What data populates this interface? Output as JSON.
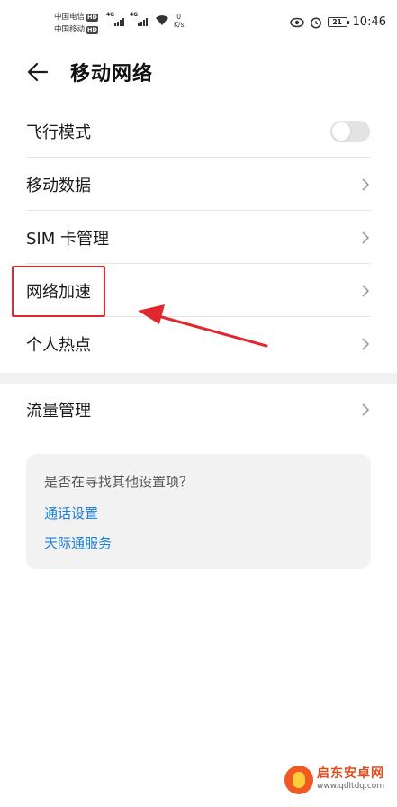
{
  "status_bar": {
    "carrier1": "中国电信",
    "carrier2": "中国移动",
    "hd": "HD",
    "net1": "4G",
    "net2": "4G",
    "speed_value": "0",
    "speed_unit": "K/s",
    "battery": "21",
    "time": "10:46"
  },
  "header": {
    "title": "移动网络"
  },
  "settings": {
    "items": [
      {
        "label": "飞行模式",
        "type": "toggle",
        "on": false
      },
      {
        "label": "移动数据",
        "type": "nav"
      },
      {
        "label": "SIM 卡管理",
        "type": "nav"
      },
      {
        "label": "网络加速",
        "type": "nav",
        "highlighted": true
      },
      {
        "label": "个人热点",
        "type": "nav"
      }
    ],
    "flow": {
      "label": "流量管理"
    }
  },
  "suggest": {
    "question": "是否在寻找其他设置项？",
    "links": [
      "通话设置",
      "天际通服务"
    ]
  },
  "watermark": {
    "name": "启东安卓网",
    "url": "www.qdltdq.com"
  },
  "colors": {
    "link": "#1a7fdc",
    "annotation": "#e0282e"
  }
}
